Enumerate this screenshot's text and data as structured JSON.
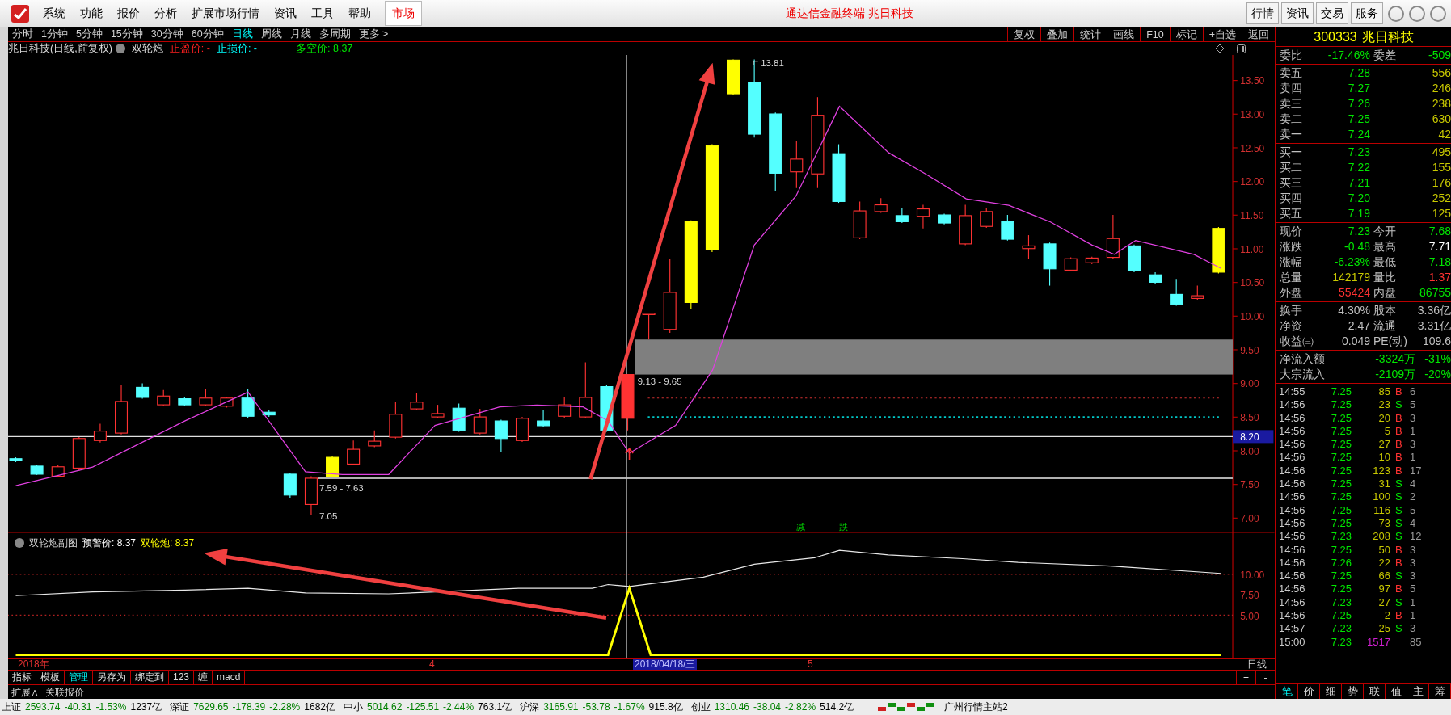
{
  "menu_bar": {
    "items": [
      "系统",
      "功能",
      "报价",
      "分析",
      "扩展市场行情",
      "资讯",
      "工具",
      "帮助"
    ],
    "market_tab": "市场",
    "title": "通达信金融终端  兆日科技",
    "buttons": [
      "行情",
      "资讯",
      "交易",
      "服务"
    ]
  },
  "period_tabs": [
    {
      "label": "分时",
      "selected": false
    },
    {
      "label": "1分钟",
      "selected": false
    },
    {
      "label": "5分钟",
      "selected": false
    },
    {
      "label": "15分钟",
      "selected": false
    },
    {
      "label": "30分钟",
      "selected": false
    },
    {
      "label": "60分钟",
      "selected": false
    },
    {
      "label": "日线",
      "selected": true
    },
    {
      "label": "周线",
      "selected": false
    },
    {
      "label": "月线",
      "selected": false
    },
    {
      "label": "多周期",
      "selected": false
    },
    {
      "label": "更多 >",
      "selected": false
    }
  ],
  "chart_tools": [
    "复权",
    "叠加",
    "统计",
    "画线",
    "F10",
    "标记",
    "+自选",
    "返回"
  ],
  "main_chart": {
    "title": "兆日科技(日线,前复权)",
    "indicator": "双轮炮",
    "take_profit": "止盈价: -",
    "stop_loss": "止损价: -",
    "long_short": "多空价: 8.37",
    "y_labels": [
      "13.50",
      "13.00",
      "12.50",
      "12.00",
      "11.50",
      "11.00",
      "10.50",
      "10.00",
      "9.50",
      "9.00",
      "8.50",
      "8.00",
      "7.50",
      "7.00"
    ],
    "current_price_tag": "8.20",
    "annotations": [
      {
        "kind": "high",
        "text": "13.81"
      },
      {
        "kind": "low",
        "text": "7.05"
      },
      {
        "kind": "zone-low",
        "text": "7.59 - 7.63"
      },
      {
        "kind": "zone-high",
        "text": "9.13 - 9.65"
      },
      {
        "kind": "signal",
        "text": "减"
      },
      {
        "kind": "signal",
        "text": "跌"
      }
    ]
  },
  "sub_chart": {
    "title": "双轮炮副图",
    "warning": "预警价: 8.37",
    "value": "双轮炮: 8.37",
    "y_labels": [
      "10.00",
      "7.50",
      "5.00"
    ]
  },
  "date_axis": {
    "labels": [
      {
        "text": "2018年",
        "cursor": false
      },
      {
        "text": "4",
        "cursor": false
      },
      {
        "text": "2018/04/18/三",
        "cursor": true
      },
      {
        "text": "5",
        "cursor": false
      }
    ],
    "period": "日线"
  },
  "bottom_tabs": [
    {
      "label": "指标",
      "selected": false
    },
    {
      "label": "模板",
      "selected": false
    },
    {
      "label": "管理",
      "selected": true
    },
    {
      "label": "另存为",
      "selected": false
    },
    {
      "label": "绑定到",
      "selected": false
    },
    {
      "label": "123",
      "selected": false
    },
    {
      "label": "缠",
      "selected": false
    },
    {
      "label": "macd",
      "selected": false
    }
  ],
  "zoom_buttons": [
    "+",
    "-"
  ],
  "bottom_links": [
    "扩展∧",
    "关联报价"
  ],
  "quote": {
    "code": "300333",
    "name": "兆日科技",
    "ratio": [
      {
        "label": "委比",
        "value": "-17.46%"
      },
      {
        "label": "委差",
        "value": "-509"
      }
    ],
    "asks": [
      {
        "label": "卖五",
        "price": "7.28",
        "volume": "556"
      },
      {
        "label": "卖四",
        "price": "7.27",
        "volume": "246"
      },
      {
        "label": "卖三",
        "price": "7.26",
        "volume": "238"
      },
      {
        "label": "卖二",
        "price": "7.25",
        "volume": "630"
      },
      {
        "label": "卖一",
        "price": "7.24",
        "volume": "42"
      }
    ],
    "bids": [
      {
        "label": "买一",
        "price": "7.23",
        "volume": "495"
      },
      {
        "label": "买二",
        "price": "7.22",
        "volume": "155"
      },
      {
        "label": "买三",
        "price": "7.21",
        "volume": "176"
      },
      {
        "label": "买四",
        "price": "7.20",
        "volume": "252"
      },
      {
        "label": "买五",
        "price": "7.19",
        "volume": "125"
      }
    ],
    "stats": [
      {
        "label": "现价",
        "value": "7.23",
        "color": "#00e600"
      },
      {
        "label": "今开",
        "value": "7.68",
        "color": "#00e600"
      },
      {
        "label": "涨跌",
        "value": "-0.48",
        "color": "#00e600"
      },
      {
        "label": "最高",
        "value": "7.71",
        "color": "#ffffff"
      },
      {
        "label": "涨幅",
        "value": "-6.23%",
        "color": "#00e600"
      },
      {
        "label": "最低",
        "value": "7.18",
        "color": "#00e600"
      },
      {
        "label": "总量",
        "value": "142179",
        "color": "#c8c800"
      },
      {
        "label": "量比",
        "value": "1.37",
        "color": "#ff3232"
      },
      {
        "label": "外盘",
        "value": "55424",
        "color": "#ff3232"
      },
      {
        "label": "内盘",
        "value": "86755",
        "color": "#00e600"
      }
    ],
    "finance": [
      {
        "label": "换手",
        "value": "4.30%"
      },
      {
        "label": "股本",
        "value": "3.36亿"
      },
      {
        "label": "净资",
        "value": "2.47"
      },
      {
        "label": "流通",
        "value": "3.31亿"
      },
      {
        "label": "收益㈢",
        "value": "0.049"
      },
      {
        "label": "PE(动)",
        "value": "109.6"
      }
    ],
    "funds": [
      {
        "label": "净流入额",
        "amount": "-3324万",
        "pct": "-31%"
      },
      {
        "label": "大宗流入",
        "amount": "-2109万",
        "pct": "-20%"
      }
    ],
    "ticks": [
      {
        "kind": "trade",
        "time": "14:55",
        "price": "7.25",
        "volume": "85",
        "side": "B",
        "color": "#ff3232",
        "extra": "6"
      },
      {
        "kind": "trade",
        "time": "14:56",
        "price": "7.25",
        "volume": "23",
        "side": "S",
        "color": "#00e600",
        "extra": "5"
      },
      {
        "kind": "trade",
        "time": "14:56",
        "price": "7.25",
        "volume": "20",
        "side": "B",
        "color": "#ff3232",
        "extra": "3"
      },
      {
        "kind": "trade",
        "time": "14:56",
        "price": "7.25",
        "volume": "5",
        "side": "B",
        "color": "#ff3232",
        "extra": "1"
      },
      {
        "kind": "trade",
        "time": "14:56",
        "price": "7.25",
        "volume": "27",
        "side": "B",
        "color": "#ff3232",
        "extra": "3"
      },
      {
        "kind": "trade",
        "time": "14:56",
        "price": "7.25",
        "volume": "10",
        "side": "B",
        "color": "#ff3232",
        "extra": "1"
      },
      {
        "kind": "trade",
        "time": "14:56",
        "price": "7.25",
        "volume": "123",
        "side": "B",
        "color": "#ff3232",
        "extra": "17"
      },
      {
        "kind": "trade",
        "time": "14:56",
        "price": "7.25",
        "volume": "31",
        "side": "S",
        "color": "#00e600",
        "extra": "4"
      },
      {
        "kind": "trade",
        "time": "14:56",
        "price": "7.25",
        "volume": "100",
        "side": "S",
        "color": "#00e600",
        "extra": "2"
      },
      {
        "kind": "trade",
        "time": "14:56",
        "price": "7.25",
        "volume": "116",
        "side": "S",
        "color": "#00e600",
        "extra": "5"
      },
      {
        "kind": "trade",
        "time": "14:56",
        "price": "7.25",
        "volume": "73",
        "side": "S",
        "color": "#00e600",
        "extra": "4"
      },
      {
        "kind": "trade",
        "time": "14:56",
        "price": "7.23",
        "volume": "208",
        "side": "S",
        "color": "#00e600",
        "extra": "12"
      },
      {
        "kind": "trade",
        "time": "14:56",
        "price": "7.25",
        "volume": "50",
        "side": "B",
        "color": "#ff3232",
        "extra": "3"
      },
      {
        "kind": "trade",
        "time": "14:56",
        "price": "7.26",
        "volume": "22",
        "side": "B",
        "color": "#ff3232",
        "extra": "3"
      },
      {
        "kind": "trade",
        "time": "14:56",
        "price": "7.25",
        "volume": "66",
        "side": "S",
        "color": "#00e600",
        "extra": "3"
      },
      {
        "kind": "trade",
        "time": "14:56",
        "price": "7.25",
        "volume": "97",
        "side": "B",
        "color": "#ff3232",
        "extra": "5"
      },
      {
        "kind": "trade",
        "time": "14:56",
        "price": "7.23",
        "volume": "27",
        "side": "S",
        "color": "#00e600",
        "extra": "1"
      },
      {
        "kind": "trade",
        "time": "14:56",
        "price": "7.25",
        "volume": "2",
        "side": "B",
        "color": "#ff3232",
        "extra": "1"
      },
      {
        "kind": "trade",
        "time": "14:57",
        "price": "7.23",
        "volume": "25",
        "side": "S",
        "color": "#00e600",
        "extra": "3"
      },
      {
        "kind": "summary",
        "time": "15:00",
        "price": "7.23",
        "volume": "1517",
        "extra": "85"
      }
    ],
    "panel_tabs": [
      {
        "label": "笔",
        "selected": true
      },
      {
        "label": "价",
        "selected": false
      },
      {
        "label": "细",
        "selected": false
      },
      {
        "label": "势",
        "selected": false
      },
      {
        "label": "联",
        "selected": false
      },
      {
        "label": "值",
        "selected": false
      },
      {
        "label": "主",
        "selected": false
      },
      {
        "label": "筹",
        "selected": false
      }
    ]
  },
  "status_bar": {
    "indices": [
      {
        "name": "上证",
        "value": "2593.74",
        "change": "-40.31",
        "pct": "-1.53%",
        "amount": "1237亿"
      },
      {
        "name": "深证",
        "value": "7629.65",
        "change": "-178.39",
        "pct": "-2.28%",
        "amount": "1682亿"
      },
      {
        "name": "中小",
        "value": "5014.62",
        "change": "-125.51",
        "pct": "-2.44%",
        "amount": "763.1亿"
      },
      {
        "name": "沪深",
        "value": "3165.91",
        "change": "-53.78",
        "pct": "-1.67%",
        "amount": "915.8亿"
      },
      {
        "name": "创业",
        "value": "1310.46",
        "change": "-38.04",
        "pct": "-2.82%",
        "amount": "514.2亿"
      }
    ],
    "server": "广州行情主站2"
  }
}
